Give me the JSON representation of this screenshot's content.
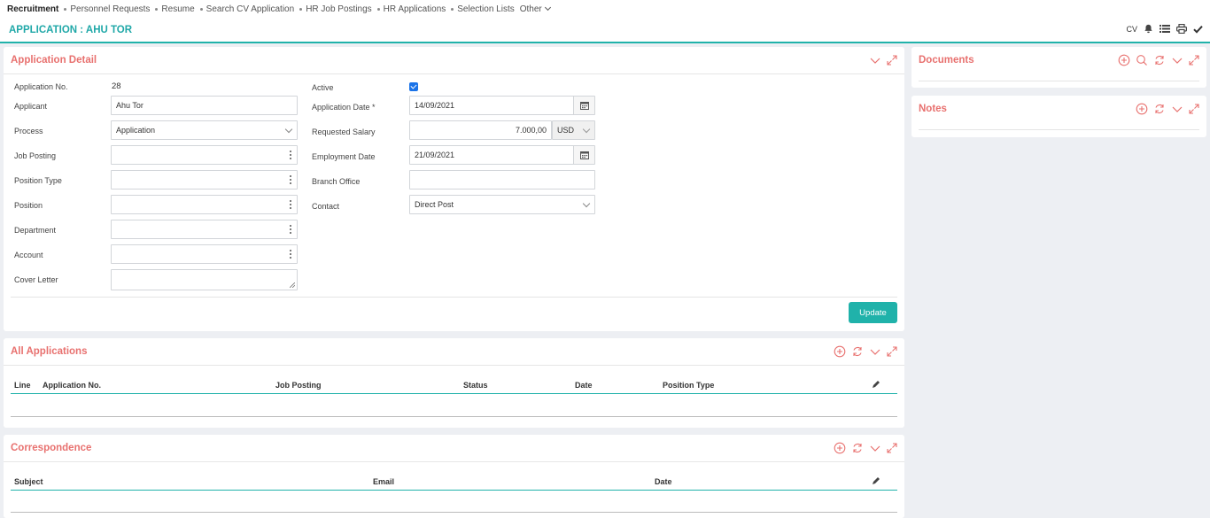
{
  "topnav": {
    "items": [
      "Recruitment",
      "Personnel Requests",
      "Resume",
      "Search CV Application",
      "HR Job Postings",
      "HR Applications",
      "Selection Lists"
    ],
    "other": "Other"
  },
  "header": {
    "title": "APPLICATION : AHU TOR",
    "cv_label": "CV"
  },
  "application_detail": {
    "title": "Application Detail",
    "fields": {
      "application_no": {
        "label": "Application No.",
        "value": "28"
      },
      "applicant": {
        "label": "Applicant",
        "value": "Ahu Tor"
      },
      "process": {
        "label": "Process",
        "value": "Application"
      },
      "job_posting": {
        "label": "Job Posting",
        "value": ""
      },
      "position_type": {
        "label": "Position Type",
        "value": ""
      },
      "position": {
        "label": "Position",
        "value": ""
      },
      "department": {
        "label": "Department",
        "value": ""
      },
      "account": {
        "label": "Account",
        "value": ""
      },
      "cover_letter": {
        "label": "Cover Letter",
        "value": ""
      },
      "active": {
        "label": "Active",
        "checked": true
      },
      "application_date": {
        "label": "Application Date *",
        "value": "14/09/2021"
      },
      "requested_salary": {
        "label": "Requested Salary",
        "value": "7.000,00",
        "currency": "USD"
      },
      "employment_date": {
        "label": "Employment Date",
        "value": "21/09/2021"
      },
      "branch_office": {
        "label": "Branch Office",
        "value": ""
      },
      "contact": {
        "label": "Contact",
        "value": "Direct Post"
      }
    },
    "update_label": "Update"
  },
  "all_applications": {
    "title": "All Applications",
    "columns": [
      "Line",
      "Application No.",
      "Job Posting",
      "Status",
      "Date",
      "Position Type"
    ],
    "rows": []
  },
  "correspondence": {
    "title": "Correspondence",
    "columns": [
      "Subject",
      "Email",
      "Date"
    ],
    "rows": []
  },
  "documents": {
    "title": "Documents"
  },
  "notes": {
    "title": "Notes"
  },
  "colors": {
    "accent": "#20b2aa",
    "section_title": "#e8716f",
    "checkbox": "#1a73e8"
  }
}
